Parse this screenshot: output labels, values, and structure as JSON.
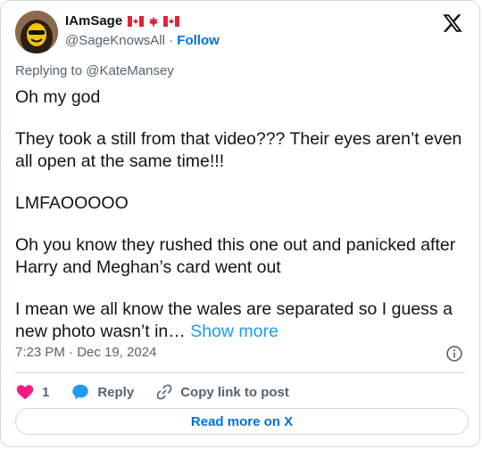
{
  "user": {
    "display_name": "IAmSage",
    "handle": "@SageKnowsAll",
    "separator": " · ",
    "follow_label": "Follow"
  },
  "replying_to": "Replying to @KateMansey",
  "tweet": {
    "paragraphs": [
      "Oh my god",
      "They took a still from that video??? Their eyes aren’t even all open at the same time!!!",
      "LMFAOOOOO",
      "Oh you know they rushed this one out and panicked after Harry and Meghan’s card went out"
    ],
    "last_paragraph": "I mean we all know the wales are separated so I guess a new photo wasn’t in… ",
    "show_more_label": "Show more"
  },
  "timestamp": "7:23 PM · Dec 19, 2024",
  "actions": {
    "like_count": "1",
    "reply_label": "Reply",
    "copy_link_label": "Copy link to post"
  },
  "read_more_label": "Read more on X",
  "colors": {
    "accent": "#1d9bf0",
    "link": "#006fd6",
    "like": "#f91880",
    "text": "#0f1419",
    "muted": "#536471",
    "border": "#cfd9de"
  },
  "icons": [
    "avatar",
    "canada-flag-icon",
    "x-logo-icon",
    "info-icon",
    "heart-icon",
    "reply-bubble-icon",
    "link-icon"
  ]
}
